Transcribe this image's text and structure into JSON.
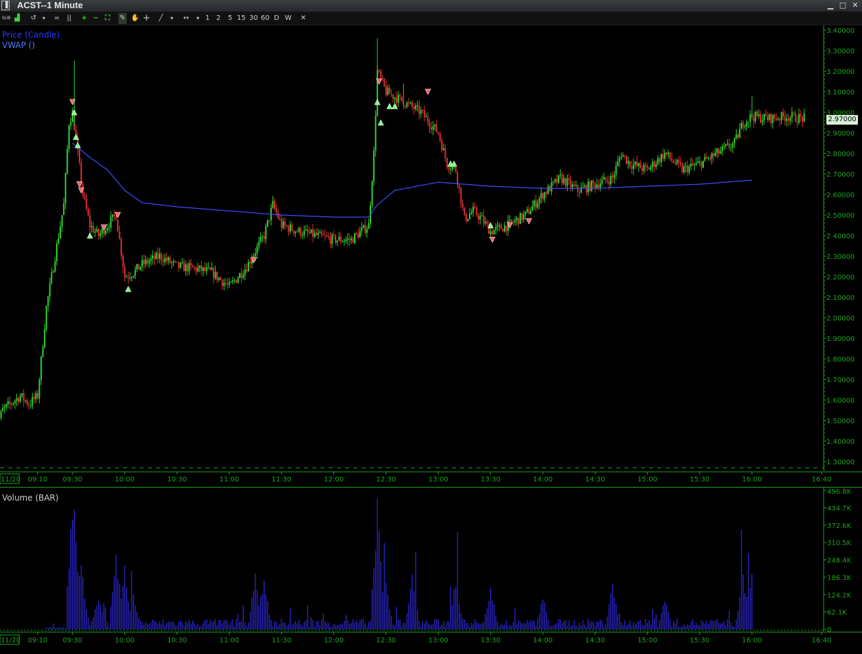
{
  "window": {
    "title": "ACST--1 Minute",
    "min_label": "▁",
    "max_label": "□",
    "close_label": "✕"
  },
  "toolbar": {
    "buttons": [
      {
        "name": "sub-button",
        "label": "SUB"
      },
      {
        "name": "chart-type-button",
        "label": "▟"
      },
      {
        "name": "undo-button",
        "label": "↺"
      },
      {
        "name": "menu-button",
        "label": "▾"
      },
      {
        "name": "lines-button",
        "label": "="
      },
      {
        "name": "bars-button",
        "label": "||"
      },
      {
        "name": "zoom-in-button",
        "label": "+"
      },
      {
        "name": "zoom-out-button",
        "label": "−"
      },
      {
        "name": "fit-button",
        "label": "⛶"
      },
      {
        "name": "draw-button",
        "label": "✎"
      },
      {
        "name": "hand-button",
        "label": "✋"
      },
      {
        "name": "crosshair-button",
        "label": "+"
      },
      {
        "name": "line-tool-button",
        "label": "╱"
      },
      {
        "name": "line-menu-button",
        "label": "▾"
      },
      {
        "name": "scroll-button",
        "label": "↔"
      },
      {
        "name": "scroll-menu-button",
        "label": "▾"
      }
    ],
    "intervals": [
      "1",
      "2",
      "5",
      "15",
      "30",
      "60",
      "D",
      "W"
    ],
    "close_label": "✕"
  },
  "price_panel": {
    "legend": [
      {
        "label": "Price (Candle)",
        "color": "#2a3bff"
      },
      {
        "label": "VWAP ()",
        "color": "#4f7bff"
      }
    ],
    "y_ticks": [
      "3.40000",
      "3.30000",
      "3.20000",
      "3.10000",
      "3.00000",
      "2.90000",
      "2.80000",
      "2.70000",
      "2.60000",
      "2.50000",
      "2.40000",
      "2.30000",
      "2.20000",
      "2.10000",
      "2.00000",
      "1.90000",
      "1.80000",
      "1.70000",
      "1.60000",
      "1.50000",
      "1.40000",
      "1.30000"
    ],
    "last_price": "2.97000"
  },
  "volume_panel": {
    "legend": "Volume (BAR)",
    "y_ticks": [
      "496.8K",
      "434.7K",
      "372.6K",
      "310.5K",
      "248.4K",
      "186.3K",
      "124.2K",
      "62.1K",
      "0"
    ]
  },
  "time_axis": {
    "date_label": "11/20",
    "labels": [
      "09:10",
      "09:30",
      "10:00",
      "10:30",
      "11:00",
      "11:30",
      "12:00",
      "12:30",
      "13:00",
      "13:30",
      "14:00",
      "14:30",
      "15:00",
      "15:30",
      "16:00",
      "16:40"
    ]
  },
  "colors": {
    "up": "#2fd52f",
    "down": "#e23030",
    "vwap": "#3d4dff",
    "volume": "#2a24c8",
    "axis": "#1fa31f"
  },
  "chart_data": [
    {
      "type": "candlestick",
      "title": "Price (Candle)",
      "ylim": [
        1.25,
        3.42
      ],
      "x_ticks": [
        "09:10",
        "09:30",
        "10:00",
        "10:30",
        "11:00",
        "11:30",
        "12:00",
        "12:30",
        "13:00",
        "13:30",
        "14:00",
        "14:30",
        "15:00",
        "15:30",
        "16:00",
        "16:40"
      ],
      "price_path": [
        [
          "08:45",
          1.45
        ],
        [
          "08:50",
          1.55
        ],
        [
          "09:00",
          1.62
        ],
        [
          "09:05",
          1.58
        ],
        [
          "09:10",
          1.62
        ],
        [
          "09:15",
          2.05
        ],
        [
          "09:20",
          2.3
        ],
        [
          "09:25",
          2.55
        ],
        [
          "09:28",
          2.95
        ],
        [
          "09:30",
          3.0
        ],
        [
          "09:33",
          2.8
        ],
        [
          "09:36",
          2.6
        ],
        [
          "09:40",
          2.45
        ],
        [
          "09:45",
          2.4
        ],
        [
          "09:50",
          2.45
        ],
        [
          "09:55",
          2.5
        ],
        [
          "10:00",
          2.2
        ],
        [
          "10:05",
          2.22
        ],
        [
          "10:10",
          2.26
        ],
        [
          "10:20",
          2.3
        ],
        [
          "10:30",
          2.25
        ],
        [
          "10:40",
          2.24
        ],
        [
          "10:50",
          2.22
        ],
        [
          "11:00",
          2.15
        ],
        [
          "11:10",
          2.25
        ],
        [
          "11:20",
          2.4
        ],
        [
          "11:25",
          2.55
        ],
        [
          "11:30",
          2.45
        ],
        [
          "11:40",
          2.42
        ],
        [
          "11:50",
          2.4
        ],
        [
          "12:00",
          2.38
        ],
        [
          "12:10",
          2.38
        ],
        [
          "12:20",
          2.45
        ],
        [
          "12:23",
          2.8
        ],
        [
          "12:25",
          3.2
        ],
        [
          "12:30",
          3.1
        ],
        [
          "12:40",
          3.05
        ],
        [
          "12:50",
          3.0
        ],
        [
          "13:00",
          2.9
        ],
        [
          "13:05",
          2.75
        ],
        [
          "13:10",
          2.72
        ],
        [
          "13:15",
          2.48
        ],
        [
          "13:20",
          2.52
        ],
        [
          "13:25",
          2.48
        ],
        [
          "13:30",
          2.42
        ],
        [
          "13:40",
          2.45
        ],
        [
          "13:50",
          2.5
        ],
        [
          "14:00",
          2.6
        ],
        [
          "14:10",
          2.68
        ],
        [
          "14:20",
          2.62
        ],
        [
          "14:30",
          2.65
        ],
        [
          "14:40",
          2.68
        ],
        [
          "14:45",
          2.8
        ],
        [
          "14:50",
          2.75
        ],
        [
          "15:00",
          2.72
        ],
        [
          "15:10",
          2.8
        ],
        [
          "15:20",
          2.72
        ],
        [
          "15:30",
          2.75
        ],
        [
          "15:40",
          2.8
        ],
        [
          "15:50",
          2.85
        ],
        [
          "15:55",
          2.95
        ],
        [
          "16:00",
          2.98
        ],
        [
          "16:10",
          2.97
        ],
        [
          "16:20",
          2.98
        ],
        [
          "16:30",
          2.97
        ]
      ],
      "vwap": [
        [
          "09:30",
          2.85
        ],
        [
          "09:40",
          2.78
        ],
        [
          "09:50",
          2.72
        ],
        [
          "10:00",
          2.62
        ],
        [
          "10:10",
          2.56
        ],
        [
          "10:30",
          2.54
        ],
        [
          "11:00",
          2.52
        ],
        [
          "11:30",
          2.5
        ],
        [
          "12:00",
          2.49
        ],
        [
          "12:20",
          2.49
        ],
        [
          "12:25",
          2.55
        ],
        [
          "12:35",
          2.62
        ],
        [
          "13:00",
          2.66
        ],
        [
          "13:30",
          2.64
        ],
        [
          "14:00",
          2.63
        ],
        [
          "14:30",
          2.63
        ],
        [
          "15:00",
          2.64
        ],
        [
          "15:30",
          2.65
        ],
        [
          "16:00",
          2.67
        ]
      ],
      "signals": [
        {
          "t": "09:30",
          "price": 3.05,
          "dir": "sell"
        },
        {
          "t": "09:31",
          "price": 3.0,
          "dir": "buy"
        },
        {
          "t": "09:32",
          "price": 2.88,
          "dir": "buy"
        },
        {
          "t": "09:33",
          "price": 2.84,
          "dir": "buy"
        },
        {
          "t": "09:34",
          "price": 2.65,
          "dir": "sell"
        },
        {
          "t": "09:35",
          "price": 2.62,
          "dir": "sell"
        },
        {
          "t": "09:40",
          "price": 2.4,
          "dir": "buy"
        },
        {
          "t": "09:48",
          "price": 2.44,
          "dir": "sell"
        },
        {
          "t": "09:56",
          "price": 2.5,
          "dir": "sell"
        },
        {
          "t": "10:02",
          "price": 2.14,
          "dir": "buy"
        },
        {
          "t": "11:14",
          "price": 2.28,
          "dir": "sell"
        },
        {
          "t": "12:25",
          "price": 3.05,
          "dir": "buy"
        },
        {
          "t": "12:26",
          "price": 3.15,
          "dir": "sell"
        },
        {
          "t": "12:27",
          "price": 2.95,
          "dir": "buy"
        },
        {
          "t": "12:32",
          "price": 3.03,
          "dir": "buy"
        },
        {
          "t": "12:35",
          "price": 3.03,
          "dir": "buy"
        },
        {
          "t": "12:54",
          "price": 3.1,
          "dir": "sell"
        },
        {
          "t": "13:07",
          "price": 2.75,
          "dir": "buy"
        },
        {
          "t": "13:09",
          "price": 2.75,
          "dir": "buy"
        },
        {
          "t": "13:30",
          "price": 2.45,
          "dir": "buy"
        },
        {
          "t": "13:31",
          "price": 2.38,
          "dir": "sell"
        },
        {
          "t": "13:41",
          "price": 2.45,
          "dir": "sell"
        },
        {
          "t": "13:52",
          "price": 2.47,
          "dir": "sell"
        }
      ]
    },
    {
      "type": "bar",
      "title": "Volume (BAR)",
      "ylim": [
        0,
        496800
      ],
      "x_ticks": [
        "09:10",
        "09:30",
        "10:00",
        "10:30",
        "11:00",
        "11:30",
        "12:00",
        "12:30",
        "13:00",
        "13:30",
        "14:00",
        "14:30",
        "15:00",
        "15:30",
        "16:00",
        "16:40"
      ],
      "peaks": [
        [
          "09:30",
          490000
        ],
        [
          "09:31",
          480000
        ],
        [
          "09:32",
          320000
        ],
        [
          "09:35",
          250000
        ],
        [
          "09:45",
          130000
        ],
        [
          "09:55",
          300000
        ],
        [
          "10:00",
          240000
        ],
        [
          "10:05",
          130000
        ],
        [
          "11:15",
          200000
        ],
        [
          "11:20",
          210000
        ],
        [
          "12:25",
          470000
        ],
        [
          "12:30",
          170000
        ],
        [
          "12:45",
          210000
        ],
        [
          "13:10",
          190000
        ],
        [
          "13:30",
          170000
        ],
        [
          "14:00",
          130000
        ],
        [
          "14:40",
          180000
        ],
        [
          "15:10",
          120000
        ],
        [
          "15:55",
          210000
        ],
        [
          "16:00",
          200000
        ]
      ]
    }
  ]
}
